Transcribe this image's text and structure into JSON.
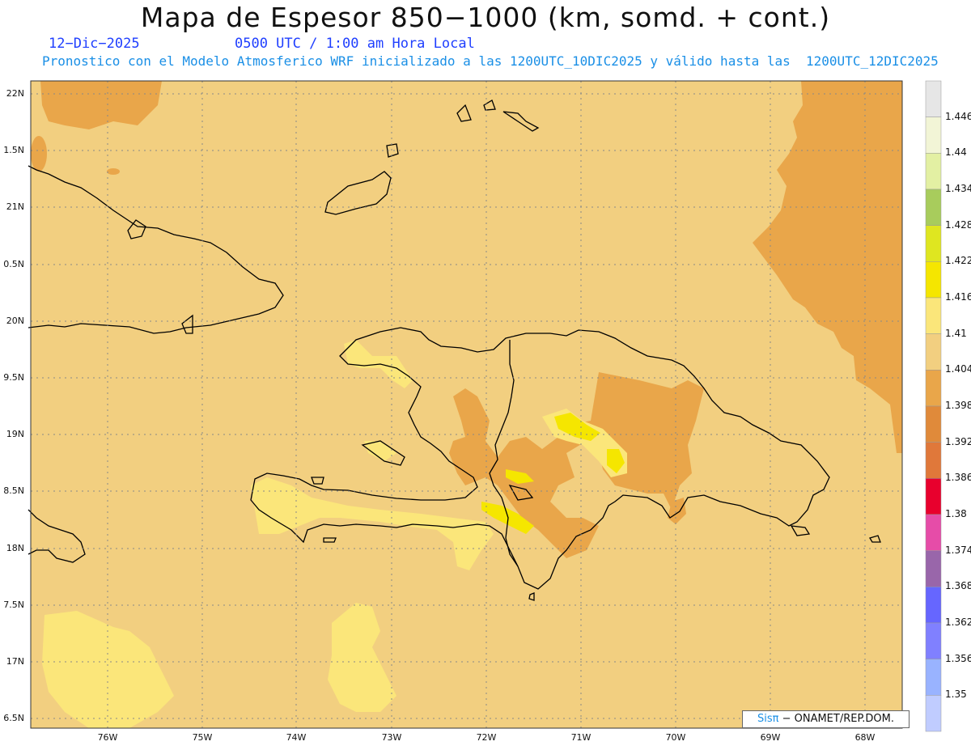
{
  "title": "Mapa de Espesor 850−1000 (km, somd. + cont.)",
  "date": "12−Dic−2025",
  "time": "0500 UTC / 1:00 am Hora Local",
  "description": "Pronostico con el Modelo Atmosferico WRF inicializado a las 1200UTC_10DIC2025 y válido hasta las  1200UTC_12DIC2025",
  "credit": {
    "brand": "Sisπ",
    "text": "− ONAMET/REP.DOM."
  },
  "lat_labels": [
    "22N",
    "1.5N",
    "21N",
    "0.5N",
    "20N",
    "9.5N",
    "19N",
    "8.5N",
    "18N",
    "7.5N",
    "17N",
    "6.5N"
  ],
  "lon_labels": [
    "76W",
    "75W",
    "74W",
    "73W",
    "72W",
    "71W",
    "70W",
    "69W",
    "68W"
  ],
  "colorbar": {
    "labels": [
      "1.446",
      "1.44",
      "1.434",
      "1.428",
      "1.422",
      "1.416",
      "1.41",
      "1.404",
      "1.398",
      "1.392",
      "1.386",
      "1.38",
      "1.374",
      "1.368",
      "1.362",
      "1.356",
      "1.35"
    ],
    "colors": [
      "#e6e6e6",
      "#f2f5d6",
      "#e3f0a3",
      "#a8cc5c",
      "#dfe620",
      "#f5e600",
      "#fbe67a",
      "#f2cf80",
      "#e9a64a",
      "#e08a3a",
      "#e0783a",
      "#e8002d",
      "#e64ca8",
      "#9966aa",
      "#6666ff",
      "#8080ff",
      "#99b3ff",
      "#c0ccff"
    ]
  },
  "map": {
    "background_fill": "#f2cf80",
    "legend_meaning": "thickness (km)"
  }
}
